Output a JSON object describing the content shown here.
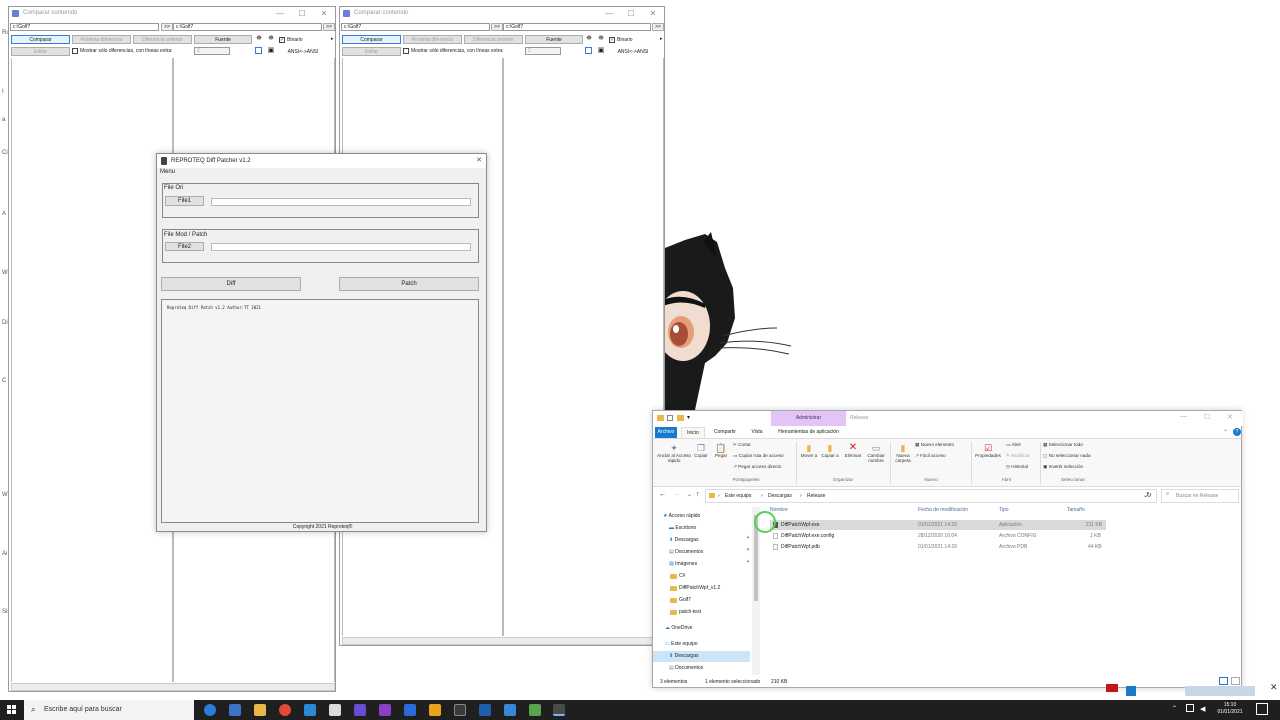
{
  "edge_glyphs": [
    "Ru",
    "I",
    "a",
    "Ci",
    "A",
    "Wi",
    "Di",
    "C",
    "Wi",
    "Ai",
    "Sis"
  ],
  "compare_windows": [
    {
      "title": "Comparar contenido",
      "left_path": "c:\\Golf7",
      "right_path": "c:\\Golf7",
      "browse": ">>",
      "btn_compare": "Comparar",
      "btn_next": "Próxima diferencia",
      "btn_prev": "Diferencia anterior",
      "btn_font": "Fuente",
      "chk_binary": "Binario",
      "btn_edit": "Editar",
      "chk_only_diff": "Mostrar sólo diferencias, con líneas extra:",
      "extra_lines": "2",
      "btn_ansi": "ANSI<->ANSI",
      "minimize": "—",
      "maximize": "☐",
      "close": "✕"
    },
    {
      "title": "Comparar contenido",
      "left_path": "c:\\Golf7",
      "right_path": "c:\\Golf7",
      "browse": ">>",
      "btn_compare": "Comparar",
      "btn_next": "Próxima diferencia",
      "btn_prev": "Diferencia anterior",
      "btn_font": "Fuente",
      "chk_binary": "Binario",
      "btn_edit": "Editar",
      "chk_only_diff": "Mostrar sólo diferencias, con líneas extra:",
      "extra_lines": "2",
      "btn_ansi": "ANSI<->ANSI",
      "minimize": "—",
      "maximize": "☐",
      "close": "✕"
    }
  ],
  "patcher": {
    "title": "REPROTEQ  Diff Patcher v1.2",
    "close": "✕",
    "menu": "Menu",
    "group1": "File Ori",
    "btn_file1": "File1",
    "group2": "File Mod / Patch",
    "btn_file2": "File2",
    "btn_diff": "Diff",
    "btn_patch": "Patch",
    "log_text": "Reproteq Diff Patch v1.2  Author:TT 2021",
    "copyright": "Copyright 2021 Reproteq®"
  },
  "explorer": {
    "context_tab": "Administrar",
    "title": "Release",
    "tabs": [
      "Archivo",
      "Inicio",
      "Compartir",
      "Vista",
      "Herramientas de aplicación"
    ],
    "ribbon": {
      "pin": "Anclar al Acceso rápido",
      "copy": "Copiar",
      "paste": "Pegar",
      "cut": "Cortar",
      "copy_path": "Copiar ruta de acceso",
      "paste_shortcut": "Pegar acceso directo",
      "move": "Mover a",
      "copy_to": "Copiar a",
      "delete": "Eliminar",
      "rename": "Cambiar nombre",
      "new_folder": "Nueva carpeta",
      "new_item": "Nuevo elemento",
      "easy_access": "Fácil acceso",
      "properties": "Propiedades",
      "open": "Abrir",
      "edit": "Modificar",
      "history": "Historial",
      "select_all": "Seleccionar todo",
      "select_none": "No seleccionar nada",
      "invert": "Invertir selección",
      "grp_clipboard": "Portapapeles",
      "grp_organize": "Organizar",
      "grp_new": "Nuevo",
      "grp_open": "Abrir",
      "grp_select": "Seleccionar"
    },
    "breadcrumb": [
      "Este equipo",
      "Descargas",
      "Release"
    ],
    "search_placeholder": "Buscar en Release",
    "columns": [
      "Nombre",
      "Fecha de modificación",
      "Tipo",
      "Tamaño"
    ],
    "nav": [
      "Acceso rápido",
      "Escritorio",
      "Descargas",
      "Documentos",
      "Imágenes",
      "C#",
      "DiffPatchWpf_v1.2",
      "Golf7",
      "patch-test",
      "OneDrive",
      "Este equipo",
      "Descargas",
      "Documentos"
    ],
    "files": [
      {
        "name": "DiffPatchWpf.exe",
        "date": "01/01/2021 14:29",
        "type": "Aplicación",
        "size": "211 KB"
      },
      {
        "name": "DiffPatchWpf.exe.config",
        "date": "28/12/2020 16:04",
        "type": "Archivo CONFIG",
        "size": "1 KB"
      },
      {
        "name": "DiffPatchWpf.pdb",
        "date": "01/01/2021 14:29",
        "type": "Archivo PDB",
        "size": "44 KB"
      }
    ],
    "status_count": "3 elementos",
    "status_selected": "1 elemento seleccionado",
    "status_size": "210 KB"
  },
  "taskbar": {
    "search_placeholder": "Escribe aquí para buscar",
    "time": "15:10",
    "date": "01/01/2021"
  }
}
